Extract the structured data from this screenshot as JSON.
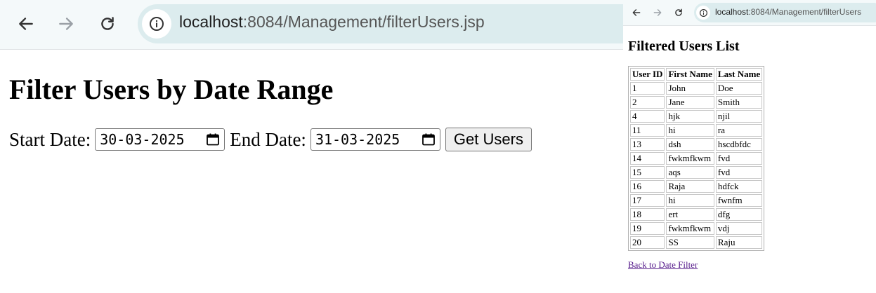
{
  "left_window": {
    "url_host": "localhost",
    "url_path": ":8084/Management/filterUsers.jsp",
    "heading": "Filter Users by Date Range",
    "start_label": "Start Date:",
    "start_value": "30-03-2025",
    "end_label": "End Date:",
    "end_value": "31-03-2025",
    "submit_label": "Get Users"
  },
  "right_window": {
    "url_host": "localhost",
    "url_path": ":8084/Management/filterUsers",
    "heading": "Filtered Users List",
    "columns": [
      "User ID",
      "First Name",
      "Last Name"
    ],
    "rows": [
      [
        "1",
        "John",
        "Doe"
      ],
      [
        "2",
        "Jane",
        "Smith"
      ],
      [
        "4",
        "hjk",
        "njil"
      ],
      [
        "11",
        "hi",
        "ra"
      ],
      [
        "13",
        "dsh",
        "hscdbfdc"
      ],
      [
        "14",
        "fwkmfkwm",
        "fvd"
      ],
      [
        "15",
        "aqs",
        "fvd"
      ],
      [
        "16",
        "Raja",
        "hdfck"
      ],
      [
        "17",
        "hi",
        "fwnfm"
      ],
      [
        "18",
        "ert",
        "dfg"
      ],
      [
        "19",
        "fwkmfkwm",
        "vdj"
      ],
      [
        "20",
        "SS",
        "Raju"
      ]
    ],
    "back_link": "Back to Date Filter"
  },
  "icons": {
    "back": "arrow-left-icon",
    "forward": "arrow-right-icon",
    "reload": "reload-icon",
    "site_info": "info-icon",
    "calendar": "calendar-icon"
  }
}
